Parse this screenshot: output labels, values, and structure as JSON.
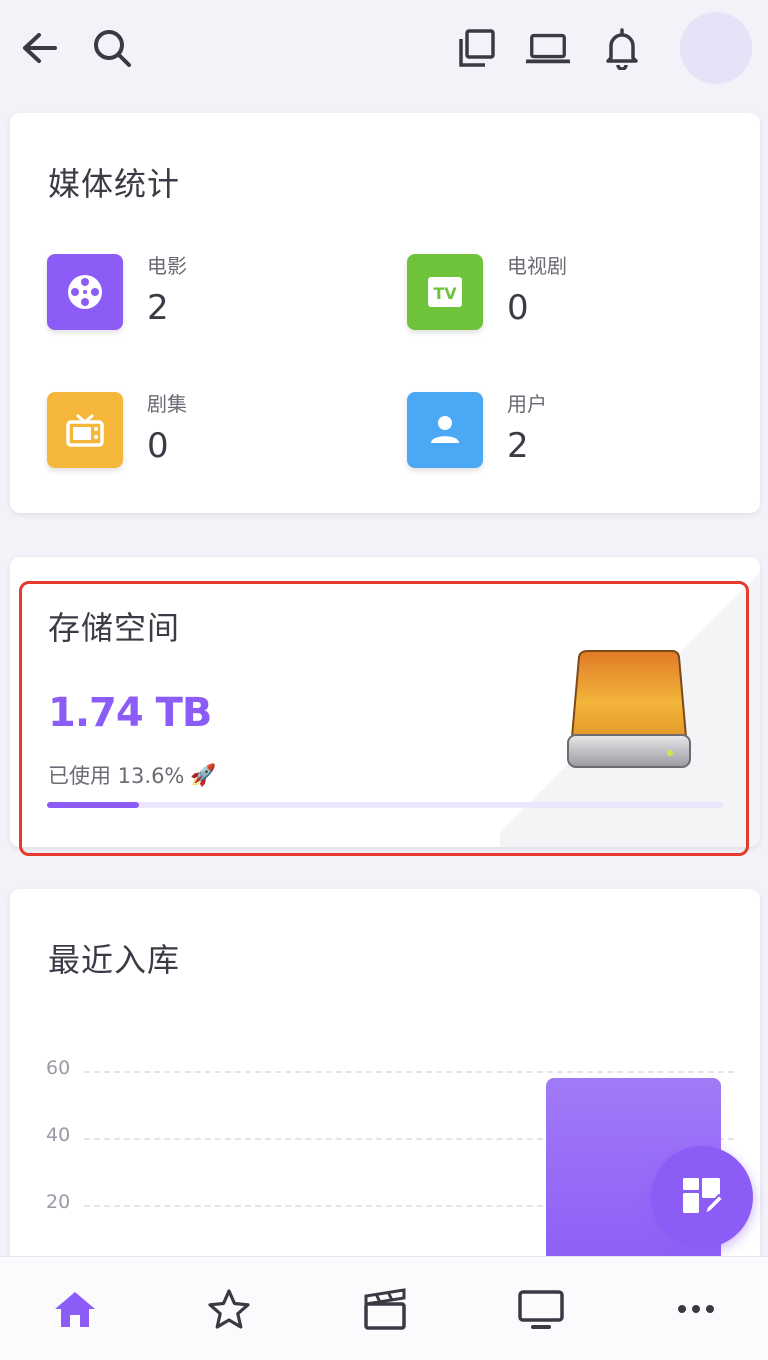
{
  "header": {
    "icons": [
      "back-arrow-icon",
      "search-icon",
      "copy-icon",
      "laptop-icon",
      "bell-icon"
    ]
  },
  "media_stats": {
    "title": "媒体统计",
    "items": [
      {
        "label": "电影",
        "value": "2",
        "icon": "film-reel-icon",
        "color": "#8b5cf6"
      },
      {
        "label": "电视剧",
        "value": "0",
        "icon": "tv-badge-icon",
        "color": "#6ec33a"
      },
      {
        "label": "剧集",
        "value": "0",
        "icon": "television-icon",
        "color": "#f4b73a"
      },
      {
        "label": "用户",
        "value": "2",
        "icon": "user-icon",
        "color": "#4aa8f5"
      }
    ]
  },
  "storage": {
    "title": "存储空间",
    "value": "1.74 TB",
    "used_label": "已使用 13.6%",
    "used_fraction": 0.136,
    "emoji": "🚀",
    "accent": "#8b5cf6",
    "icon": "hard-drive-icon"
  },
  "recent": {
    "title": "最近入库",
    "yticks": [
      "60",
      "40",
      "20"
    ]
  },
  "chart_data": {
    "type": "bar",
    "categories": [
      ""
    ],
    "values": [
      58
    ],
    "title": "",
    "xlabel": "",
    "ylabel": "",
    "ylim": [
      0,
      60
    ],
    "yticks": [
      20,
      40,
      60
    ],
    "color": "#9b72f5",
    "grid": true
  },
  "fab": {
    "icon": "dashboard-edit-icon"
  },
  "bottom_nav": {
    "items": [
      "home-icon",
      "star-icon",
      "clapperboard-icon",
      "monitor-icon",
      "more-icon"
    ],
    "active_color": "#8b5cf6"
  }
}
